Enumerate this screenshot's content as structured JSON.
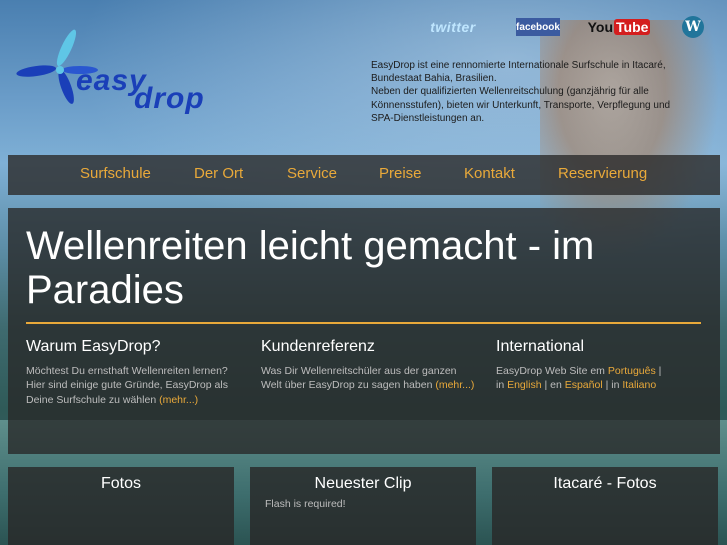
{
  "social": {
    "twitter": "twitter",
    "facebook": "facebook",
    "youtube_you": "You",
    "youtube_tube": "Tube",
    "wordpress": "W"
  },
  "logo": {
    "easy": "easy",
    "drop": "drop"
  },
  "intro": {
    "lines": [
      "EasyDrop ist eine rennomierte Internationale Surfschule in Itacaré,",
      "Bundestaat Bahia, Brasilien.",
      "Neben der qualifizierten Wellenreitschulung (ganzjährig für alle",
      "Könnensstufen), bieten wir Unterkunft, Transporte, Verpflegung und",
      "SPA-Dienstleistungen an."
    ]
  },
  "nav": [
    "Surfschule",
    "Der Ort",
    "Service",
    "Preise",
    "Kontakt",
    "Reservierung"
  ],
  "hero": {
    "title": "Wellenreiten leicht gemacht - im Paradies",
    "columns": {
      "warum": {
        "heading": "Warum EasyDrop?",
        "text": "Möchtest Du ernsthaft Wellenreiten lernen? Hier sind einige gute Gründe, EasyDrop als Deine Surfschule zu wählen ",
        "link": "(mehr...)"
      },
      "kunden": {
        "heading": "Kundenreferenz",
        "text": "Was Dir Wellenreitschüler aus der ganzen Welt über EasyDrop zu sagen haben ",
        "link": "(mehr...)"
      },
      "international": {
        "heading": "International",
        "text1": "EasyDrop Web Site em ",
        "pt": "Português",
        "sep1": " |",
        "in": "in ",
        "en": "English",
        "sep2": " | en ",
        "es": "Español",
        "sep3": " | in ",
        "it": "Italiano"
      }
    }
  },
  "boxes": {
    "fotos": "Fotos",
    "clip": "Neuester Clip",
    "clip_note": "Flash is required!",
    "itacare": "Itacaré - Fotos"
  },
  "colors": {
    "accent": "#e9a93a",
    "logo_blue": "#1a3fb8"
  }
}
